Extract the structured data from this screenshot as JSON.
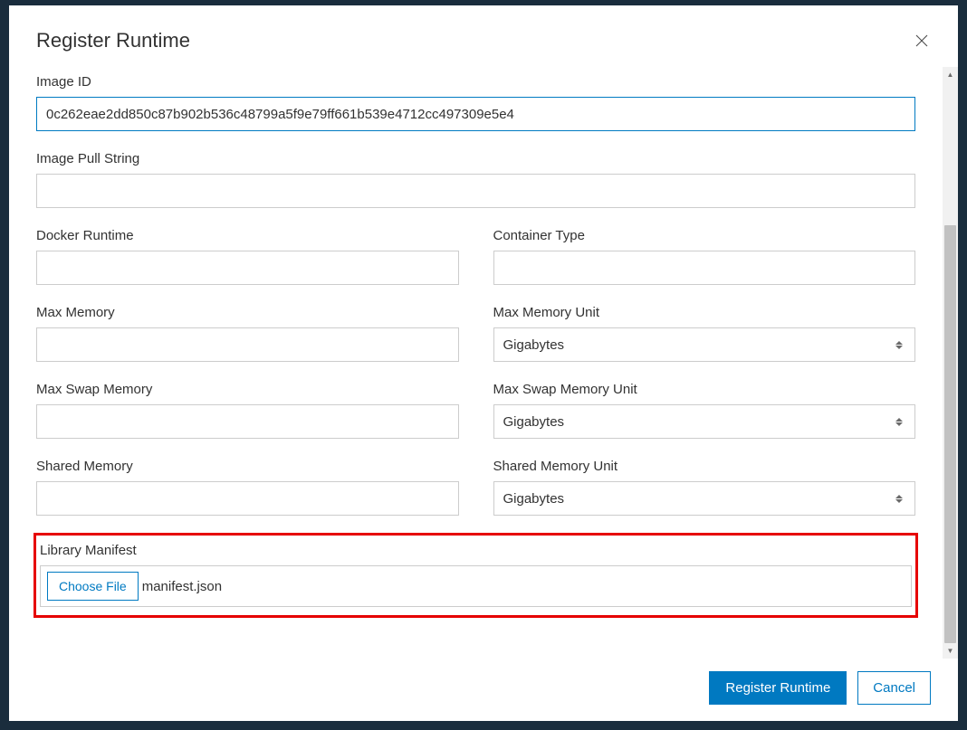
{
  "modal": {
    "title": "Register Runtime"
  },
  "fields": {
    "image_id": {
      "label": "Image ID",
      "value": "0c262eae2dd850c87b902b536c48799a5f9e79ff661b539e4712cc497309e5e4"
    },
    "image_pull_string": {
      "label": "Image Pull String",
      "value": ""
    },
    "docker_runtime": {
      "label": "Docker Runtime",
      "value": ""
    },
    "container_type": {
      "label": "Container Type",
      "value": ""
    },
    "max_memory": {
      "label": "Max Memory",
      "value": ""
    },
    "max_memory_unit": {
      "label": "Max Memory Unit",
      "value": "Gigabytes"
    },
    "max_swap_memory": {
      "label": "Max Swap Memory",
      "value": ""
    },
    "max_swap_memory_unit": {
      "label": "Max Swap Memory Unit",
      "value": "Gigabytes"
    },
    "shared_memory": {
      "label": "Shared Memory",
      "value": ""
    },
    "shared_memory_unit": {
      "label": "Shared Memory Unit",
      "value": "Gigabytes"
    },
    "library_manifest": {
      "label": "Library Manifest",
      "choose_label": "Choose File",
      "file_name": "manifest.json"
    }
  },
  "footer": {
    "primary": "Register Runtime",
    "cancel": "Cancel"
  }
}
